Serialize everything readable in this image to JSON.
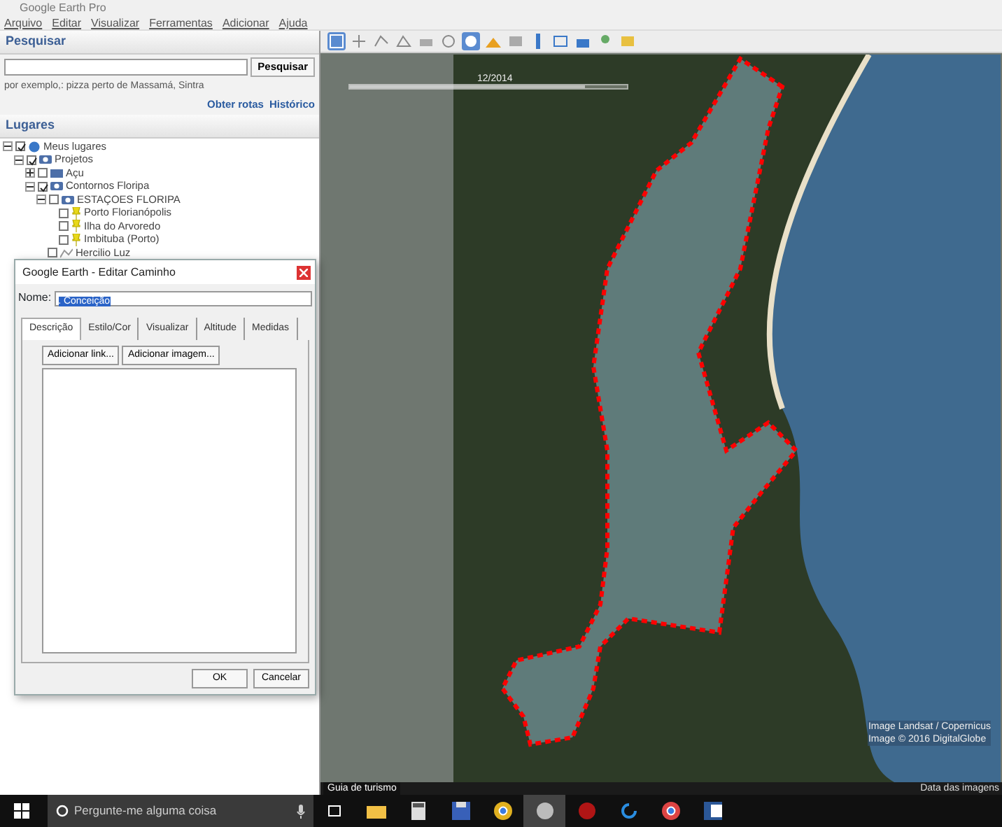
{
  "window": {
    "title": "Google Earth Pro"
  },
  "menu": [
    "Arquivo",
    "Editar",
    "Visualizar",
    "Ferramentas",
    "Adicionar",
    "Ajuda"
  ],
  "search": {
    "title": "Pesquisar",
    "button": "Pesquisar",
    "hint": "por exemplo,: pizza perto de Massamá, Sintra",
    "links": [
      "Obter rotas",
      "Histórico"
    ]
  },
  "places": {
    "title": "Lugares",
    "tree": [
      {
        "label": "Meus lugares",
        "kind": "globe",
        "checked": true,
        "expanded": true,
        "children": [
          {
            "label": "Projetos",
            "kind": "folder",
            "checked": true,
            "expanded": true,
            "children": [
              {
                "label": "Açu",
                "kind": "closed-folder",
                "checked": false,
                "expanded": false
              },
              {
                "label": "Contornos Floripa",
                "kind": "folder",
                "checked": true,
                "expanded": true,
                "children": [
                  {
                    "label": "ESTAÇOES FLORIPA",
                    "kind": "folder",
                    "checked": false,
                    "expanded": true,
                    "children": [
                      {
                        "label": "Porto Florianópolis",
                        "kind": "pin",
                        "checked": false
                      },
                      {
                        "label": "Ilha do Arvoredo",
                        "kind": "pin",
                        "checked": false
                      },
                      {
                        "label": "Imbituba (Porto)",
                        "kind": "pin",
                        "checked": false
                      }
                    ]
                  },
                  {
                    "label": "Hercilio Luz",
                    "kind": "path",
                    "checked": false
                  }
                ]
              }
            ]
          }
        ]
      }
    ]
  },
  "toolbar": [
    {
      "selected": true
    },
    {
      "selected": false
    },
    {
      "selected": false
    },
    {
      "selected": false
    },
    {
      "selected": false
    },
    {
      "selected": false
    },
    {
      "selected": true
    },
    {
      "selected": false
    },
    {
      "selected": false
    },
    {
      "selected": false
    },
    {
      "selected": false
    },
    {
      "selected": false
    },
    {
      "selected": false
    },
    {
      "selected": false
    }
  ],
  "map": {
    "time_slider": {
      "level": 0.85
    },
    "date": "12/2014",
    "attributions": [
      "Image Landsat / Copernicus",
      "Image © 2016 DigitalGlobe"
    ],
    "footer": "Data das imagens",
    "tour_tab": "Guia de turismo"
  },
  "dialog": {
    "title": "Google Earth - Editar Caminho",
    "name_label": "Nome:",
    "name_value": ". Conceição",
    "tabs": [
      {
        "label": "Descrição",
        "selected": true
      },
      {
        "label": "Estilo/Cor",
        "selected": false
      },
      {
        "label": "Visualizar",
        "selected": false
      },
      {
        "label": "Altitude",
        "selected": false
      },
      {
        "label": "Medidas",
        "selected": false
      }
    ],
    "buttons": [
      "Adicionar link...",
      "Adicionar imagem..."
    ],
    "ok": "OK",
    "cancel": "Cancelar"
  },
  "taskbar": {
    "search_placeholder": "Pergunte-me alguma coisa"
  }
}
